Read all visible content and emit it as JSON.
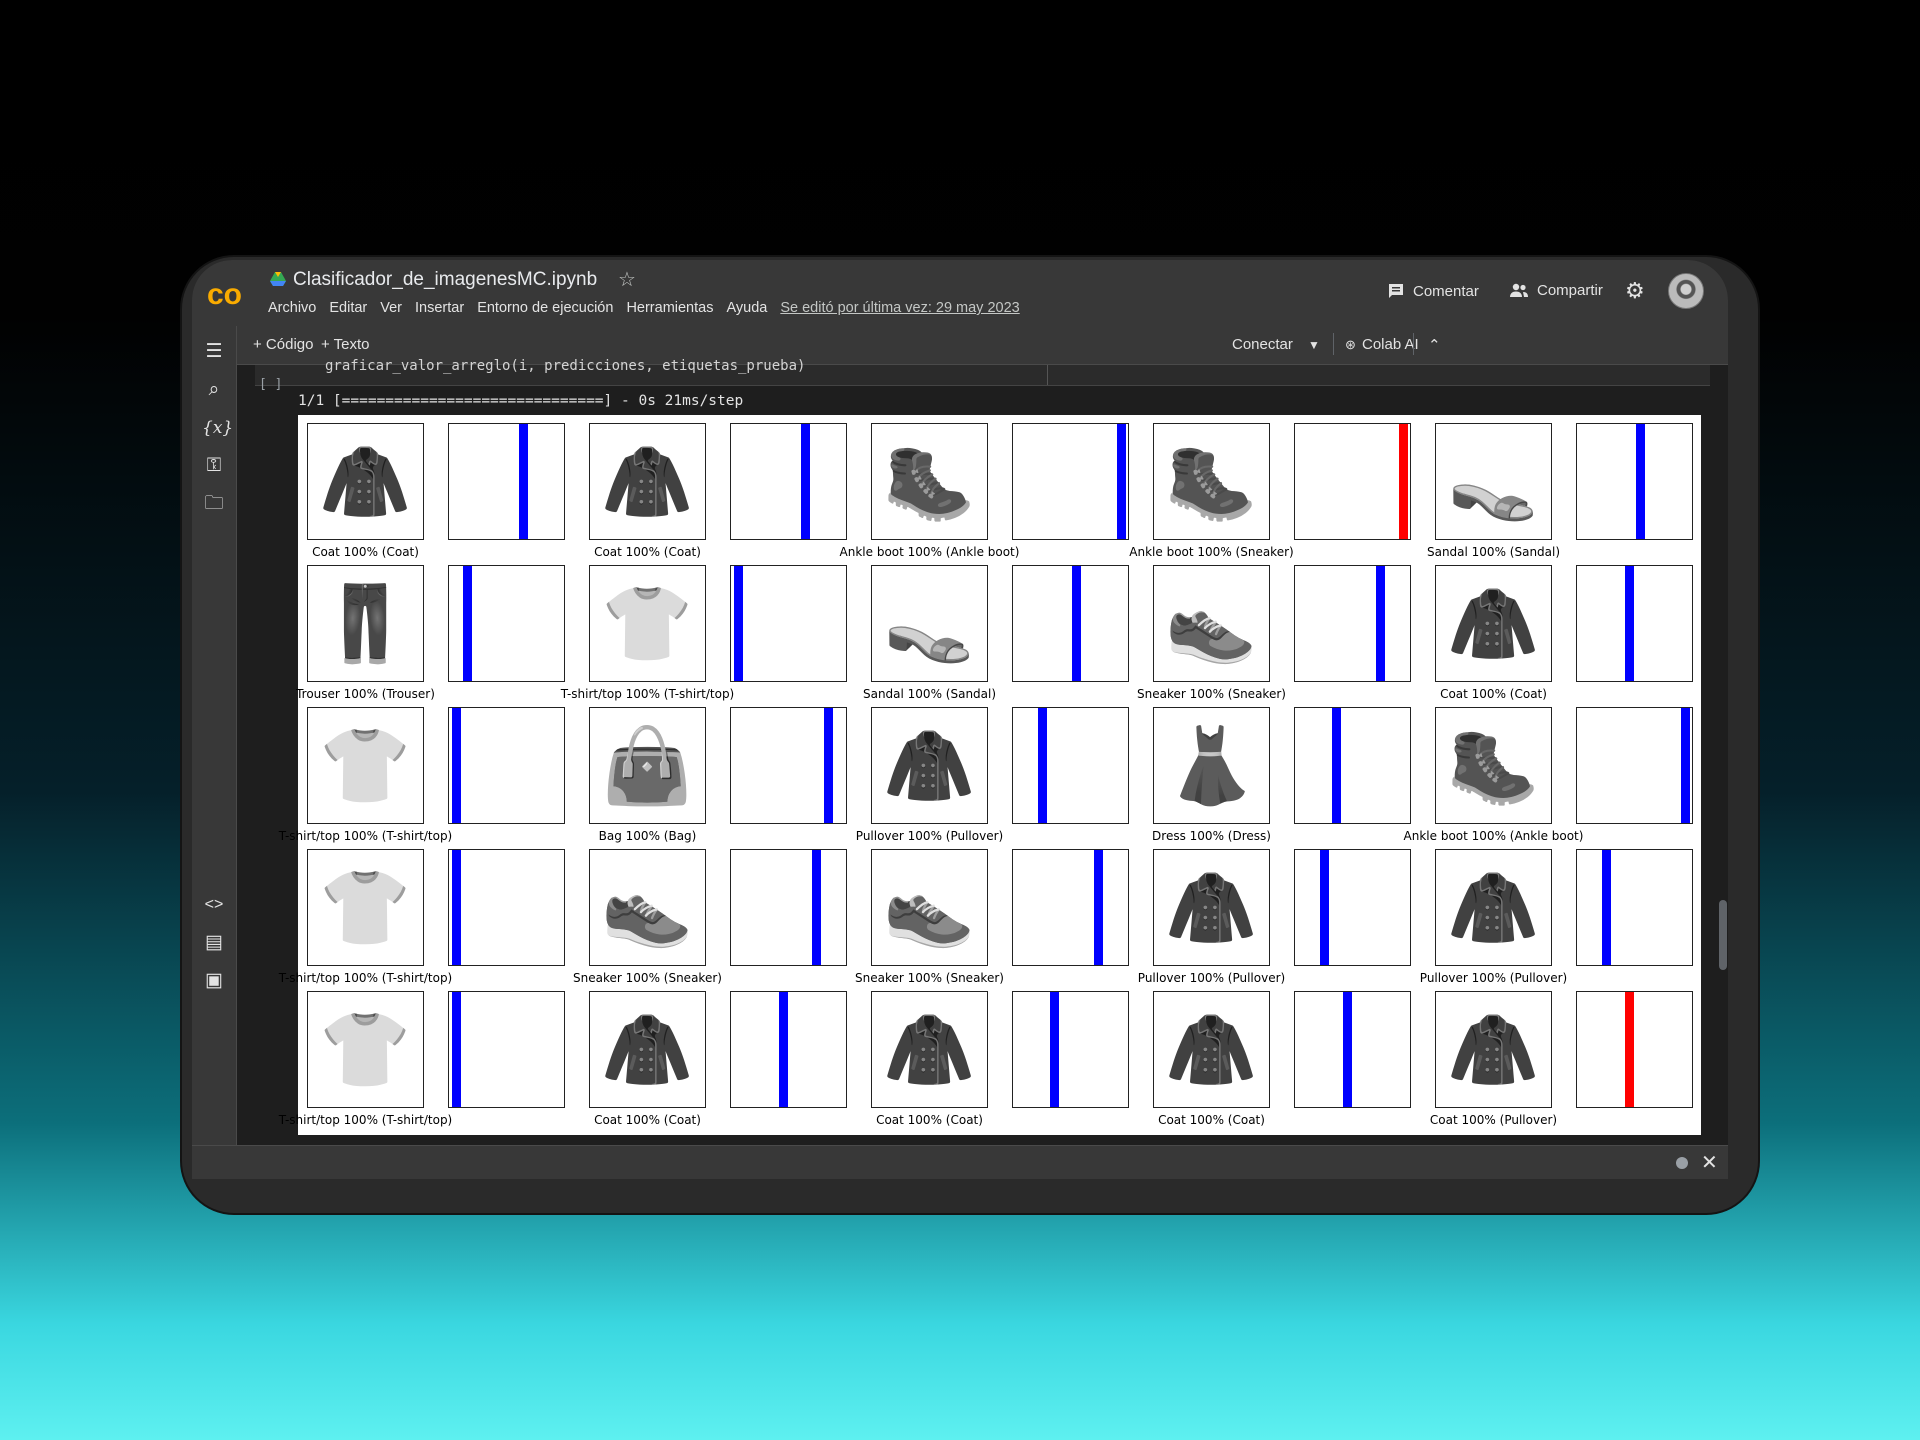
{
  "app": {
    "notebook_title": "Clasificador_de_imagenesMC.ipynb",
    "menu": [
      "Archivo",
      "Editar",
      "Ver",
      "Insertar",
      "Entorno de ejecución",
      "Herramientas",
      "Ayuda"
    ],
    "last_edited": "Se editó por última vez: 29 may 2023",
    "comment_label": "Comentar",
    "share_label": "Compartir"
  },
  "toolbar": {
    "add_code": "+ Código",
    "add_text": "+ Texto",
    "connect": "Conectar",
    "colab_ai": "Colab AI"
  },
  "cell": {
    "code": "graficar_valor_arreglo(i, predicciones, etiquetas_prueba)",
    "run_marker": "[ ]",
    "output_progress": "1/1 [==============================] - 0s 21ms/step"
  },
  "colors": {
    "correct_bar": "#0000ff",
    "wrong_bar": "#ff0000",
    "accent_logo": "#f9ab00"
  },
  "chart_data": {
    "type": "bar",
    "rows": 5,
    "cols": 5,
    "panels": [
      {
        "item": "coat",
        "caption": "Coat 100% (Coat)",
        "predicted_class": 6,
        "correct": true
      },
      {
        "item": "coat",
        "caption": "Coat 100% (Coat)",
        "predicted_class": 6,
        "correct": true
      },
      {
        "item": "boot",
        "caption": "Ankle boot 100% (Ankle boot)",
        "predicted_class": 9,
        "correct": true
      },
      {
        "item": "boot",
        "caption": "Ankle boot 100% (Sneaker)",
        "predicted_class": 9,
        "correct": false
      },
      {
        "item": "sandal",
        "caption": "Sandal 100% (Sandal)",
        "predicted_class": 5,
        "correct": true
      },
      {
        "item": "trouser",
        "caption": "Trouser 100% (Trouser)",
        "predicted_class": 1,
        "correct": true
      },
      {
        "item": "tshirt",
        "caption": "T-shirt/top 100% (T-shirt/top)",
        "predicted_class": 0,
        "correct": true
      },
      {
        "item": "sandal",
        "caption": "Sandal 100% (Sandal)",
        "predicted_class": 5,
        "correct": true
      },
      {
        "item": "sneaker",
        "caption": "Sneaker 100% (Sneaker)",
        "predicted_class": 7,
        "correct": true
      },
      {
        "item": "coat",
        "caption": "Coat 100% (Coat)",
        "predicted_class": 4,
        "correct": true
      },
      {
        "item": "tshirt",
        "caption": "T-shirt/top 100% (T-shirt/top)",
        "predicted_class": 0,
        "correct": true
      },
      {
        "item": "bag",
        "caption": "Bag 100% (Bag)",
        "predicted_class": 8,
        "correct": true
      },
      {
        "item": "pullover",
        "caption": "Pullover 100% (Pullover)",
        "predicted_class": 2,
        "correct": true
      },
      {
        "item": "dress",
        "caption": "Dress 100% (Dress)",
        "predicted_class": 3,
        "correct": true
      },
      {
        "item": "boot",
        "caption": "Ankle boot 100% (Ankle boot)",
        "predicted_class": 9,
        "correct": true
      },
      {
        "item": "tshirt",
        "caption": "T-shirt/top 100% (T-shirt/top)",
        "predicted_class": 0,
        "correct": true
      },
      {
        "item": "sneaker",
        "caption": "Sneaker 100% (Sneaker)",
        "predicted_class": 7,
        "correct": true
      },
      {
        "item": "sneaker",
        "caption": "Sneaker 100% (Sneaker)",
        "predicted_class": 7,
        "correct": true
      },
      {
        "item": "pullover",
        "caption": "Pullover 100% (Pullover)",
        "predicted_class": 2,
        "correct": true
      },
      {
        "item": "pullover",
        "caption": "Pullover 100% (Pullover)",
        "predicted_class": 2,
        "correct": true
      },
      {
        "item": "tshirt",
        "caption": "T-shirt/top 100% (T-shirt/top)",
        "predicted_class": 0,
        "correct": true
      },
      {
        "item": "coat",
        "caption": "Coat 100% (Coat)",
        "predicted_class": 4,
        "correct": true
      },
      {
        "item": "coat",
        "caption": "Coat 100% (Coat)",
        "predicted_class": 3,
        "correct": true
      },
      {
        "item": "coat",
        "caption": "Coat 100% (Coat)",
        "predicted_class": 4,
        "correct": true
      },
      {
        "item": "coat",
        "caption": "Coat 100% (Pullover)",
        "predicted_class": 4,
        "correct": false
      }
    ]
  }
}
